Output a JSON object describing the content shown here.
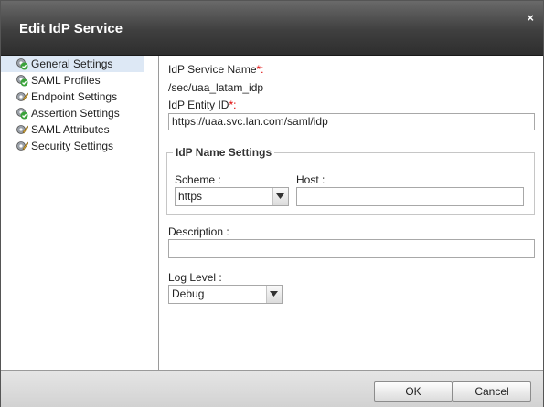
{
  "dialog": {
    "title": "Edit IdP Service",
    "close_glyph": "×"
  },
  "sidebar": {
    "items": [
      {
        "label": "General Settings",
        "icon": "check-gear-icon",
        "selected": true
      },
      {
        "label": "SAML Profiles",
        "icon": "check-gear-icon"
      },
      {
        "label": "Endpoint Settings",
        "icon": "pencil-gear-icon"
      },
      {
        "label": "Assertion Settings",
        "icon": "check-gear-icon"
      },
      {
        "label": "SAML Attributes",
        "icon": "pencil-gear-icon"
      },
      {
        "label": "Security Settings",
        "icon": "pencil-gear-icon"
      }
    ]
  },
  "form": {
    "service_name_label": "IdP Service Name",
    "service_name_value": "/sec/uaa_latam_idp",
    "entity_id_label": "IdP Entity ID",
    "entity_id_value": "https://uaa.svc.lan.com/saml/idp",
    "required_mark": "*:",
    "name_settings": {
      "legend": "IdP Name Settings",
      "scheme_label": "Scheme :",
      "scheme_value": "https",
      "host_label": "Host :",
      "host_value": ""
    },
    "description_label": "Description :",
    "description_value": "",
    "log_level_label": "Log Level :",
    "log_level_value": "Debug"
  },
  "footer": {
    "ok_label": "OK",
    "cancel_label": "Cancel"
  },
  "colors": {
    "required": "#dd0000",
    "titlebar": "#3f3f3f",
    "selected_nav": "#dde8f5"
  }
}
